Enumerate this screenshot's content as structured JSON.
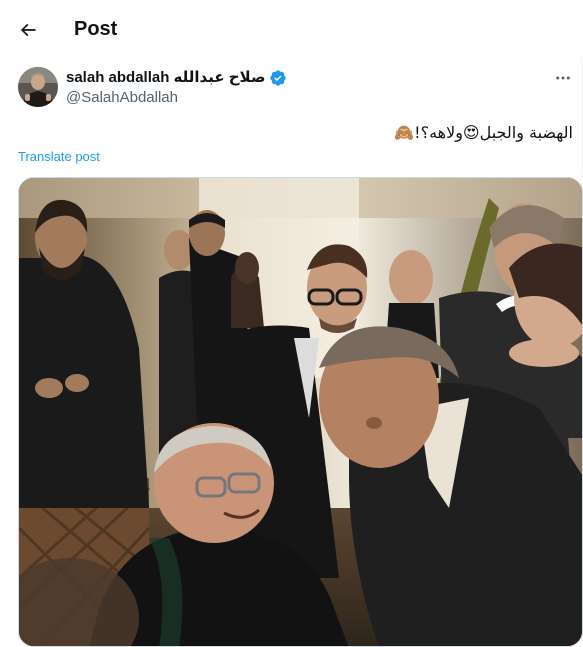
{
  "header": {
    "title": "Post",
    "back_icon": "arrow-left-icon"
  },
  "author": {
    "name": "salah abdallah صلاح عبدالله",
    "handle": "@SalahAbdallah",
    "verified": true,
    "verified_color": "#1d9bf0",
    "more_icon": "more-horizontal-icon"
  },
  "post": {
    "text": "الهضبة والجبل😍ولاهه؟!🙈",
    "translate_label": "Translate post",
    "media_type": "photo"
  },
  "colors": {
    "accent": "#1d9bf0",
    "text_primary": "#0f1419",
    "text_secondary": "#536471"
  }
}
